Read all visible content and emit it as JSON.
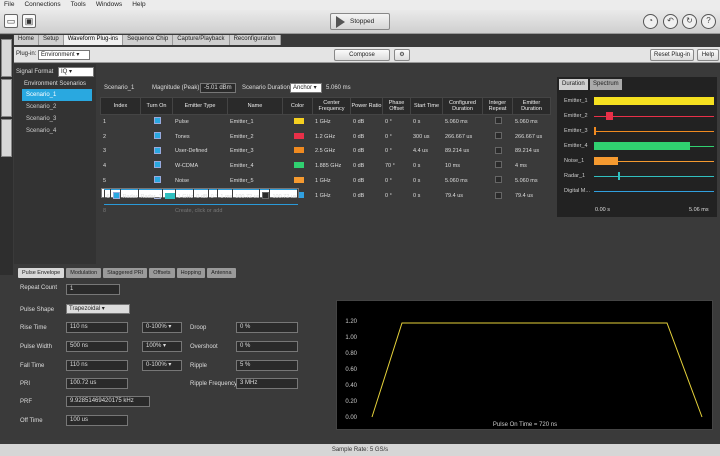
{
  "menu": [
    "File",
    "Connections",
    "Tools",
    "Windows",
    "Help"
  ],
  "toolbar": {
    "stopped": "Stopped"
  },
  "tabs": [
    "Home",
    "Setup",
    "Waveform Plug-ins",
    "Sequence Chip",
    "Capture/Playback",
    "Reconfiguration"
  ],
  "plugin": {
    "label": "Plug-in:",
    "value": "Environment",
    "compose": "Compose",
    "reset": "Reset Plug-in",
    "help": "Help"
  },
  "signal_format": {
    "label": "Signal Format",
    "value": "IQ"
  },
  "scenarios": {
    "title": "Environment Scenarios",
    "items": [
      "Scenario_1",
      "Scenario_2",
      "Scenario_3",
      "Scenario_4"
    ],
    "current": "Scenario_1"
  },
  "magnitude": {
    "label": "Magnitude (Peak)",
    "value": "-5.01 dBm"
  },
  "duration": {
    "label": "Scenario Duration",
    "mode": "Anchor",
    "value": "5.060 ms"
  },
  "grid": {
    "headers": [
      "Index",
      "Turn On",
      "Emitter Type",
      "Name",
      "Color",
      "Center Frequency",
      "Power Ratio",
      "Phase Offset",
      "Start Time",
      "Configured Duration",
      "Integer Repeat",
      "Emitter Duration"
    ],
    "rows": [
      [
        "1",
        "1",
        "Pulse",
        "Emitter_1",
        "#f5d020",
        "1 GHz",
        "0 dB",
        "0 °",
        "0 s",
        "5.060 ms",
        "",
        "5.060 ms"
      ],
      [
        "2",
        "1",
        "Tones",
        "Emitter_2",
        "#e83048",
        "1.2 GHz",
        "0 dB",
        "0 °",
        "300 us",
        "266.667 us",
        "",
        "266.667 us"
      ],
      [
        "3",
        "1",
        "User-Defined",
        "Emitter_3",
        "#f08a20",
        "2.5 GHz",
        "0 dB",
        "0 °",
        "4.4 us",
        "89.214 us",
        "",
        "89.214 us"
      ],
      [
        "4",
        "1",
        "W-CDMA",
        "Emitter_4",
        "#30d070",
        "1.885 GHz",
        "0 dB",
        "70 °",
        "0 s",
        "10 ms",
        "",
        "4 ms"
      ],
      [
        "5",
        "1",
        "Noise",
        "Emitter_5",
        "#f59a30",
        "1 GHz",
        "0 dB",
        "0 °",
        "0 s",
        "5.060 ms",
        "",
        "5.060 ms"
      ],
      [
        "6",
        "1",
        "Radar",
        "Radar_1",
        "#30c0c0",
        "1 GHz",
        "0 dB",
        "0 °",
        "1 ms",
        "100.72 us",
        "",
        "100.72 us"
      ],
      [
        "7",
        "1",
        "Digital Modulation",
        "Digital Modulatio...",
        "#30a0e0",
        "1 GHz",
        "0 dB",
        "0 °",
        "0 s",
        "79.4 us",
        "",
        "79.4 us"
      ],
      [
        "8",
        "",
        "Create, click or add",
        "",
        "",
        "",
        "",
        "",
        "",
        "",
        "",
        ""
      ]
    ]
  },
  "right_panel": {
    "tabs": [
      "Duration",
      "Spectrum"
    ],
    "lanes": [
      "Emitter_1",
      "Emitter_2",
      "Emitter_3",
      "Emitter_4",
      "Noise_1",
      "Radar_1",
      "Digital M..."
    ],
    "axis_start": "0.00 s",
    "axis_end": "5.06 ms"
  },
  "pulse_tabs": [
    "Pulse Envelope",
    "Modulation",
    "Staggered PRI",
    "Offsets",
    "Hopping",
    "Antenna"
  ],
  "form": {
    "repeat_count": {
      "label": "Repeat Count",
      "value": "1"
    },
    "pulse_shape": {
      "label": "Pulse Shape",
      "value": "Trapezoidal"
    },
    "rise_time": {
      "label": "Rise Time",
      "value": "110 ns",
      "range": "0-100%"
    },
    "pulse_width": {
      "label": "Pulse Width",
      "value": "500 ns",
      "range": "100%"
    },
    "fall_time": {
      "label": "Fall Time",
      "value": "110 ns",
      "range": "0-100%"
    },
    "pri": {
      "label": "PRI",
      "value": "100.72 us"
    },
    "prf": {
      "label": "PRF",
      "value": "9.92851469420175 kHz"
    },
    "off_time": {
      "label": "Off Time",
      "value": "100 us"
    },
    "droop": {
      "label": "Droop",
      "value": "0 %"
    },
    "overshoot": {
      "label": "Overshoot",
      "value": "0 %"
    },
    "ripple": {
      "label": "Ripple",
      "value": "5 %"
    },
    "ripple_freq": {
      "label": "Ripple Frequency",
      "value": "3 MHz"
    }
  },
  "pulse_plot": {
    "yticks": [
      "1.20",
      "1.00",
      "0.80",
      "0.60",
      "0.40",
      "0.20",
      "0.00"
    ],
    "caption": "Pulse On Time = 720 ns"
  },
  "status": "Sample Rate: 5 GS/s"
}
